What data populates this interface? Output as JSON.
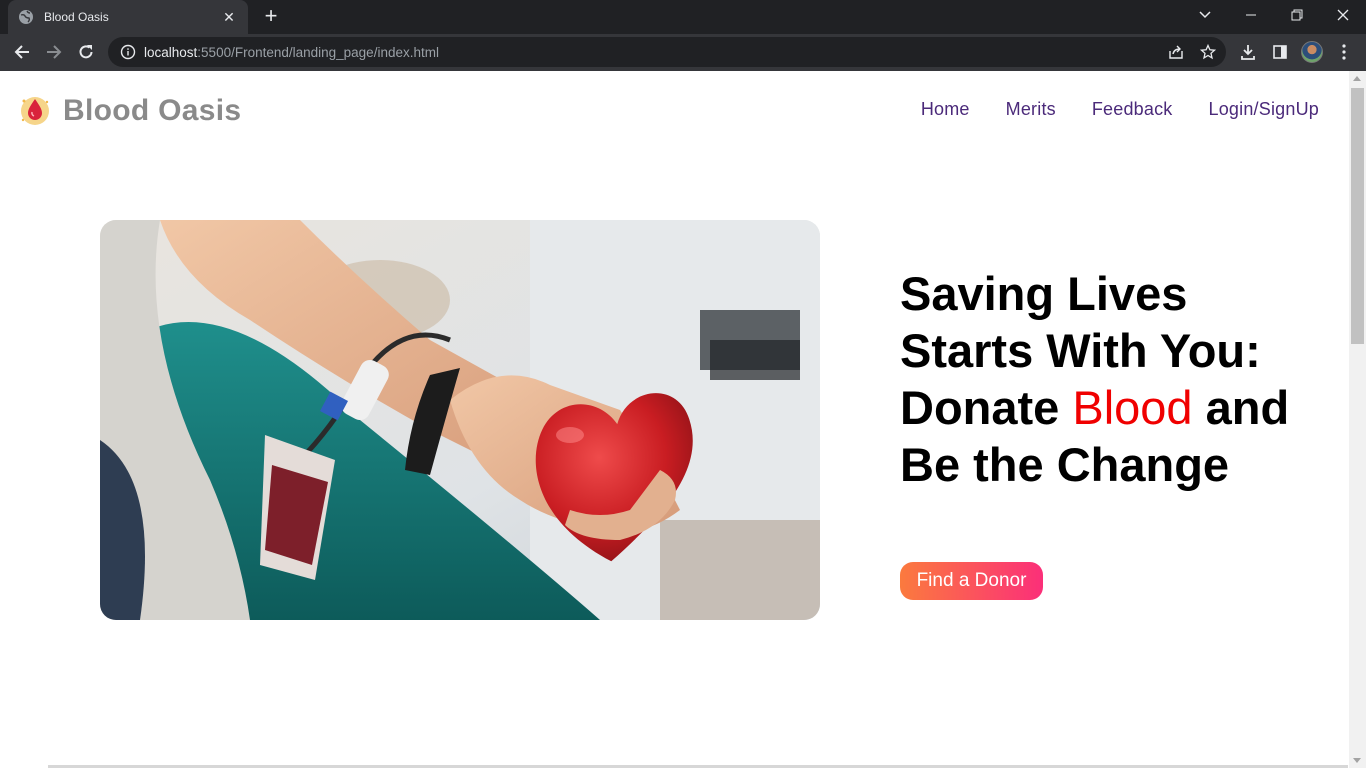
{
  "browser": {
    "tab_title": "Blood Oasis",
    "tab_close": "✕",
    "new_tab": "+",
    "url_host": "localhost",
    "url_path": ":5500/Frontend/landing_page/index.html"
  },
  "site": {
    "brand": "Blood Oasis",
    "nav": [
      "Home",
      "Merits",
      "Feedback",
      "Login/SignUp"
    ]
  },
  "hero": {
    "headline_part1": "Saving Lives Starts With You: Donate ",
    "headline_highlight": "Blood",
    "headline_part2": " and Be the Change",
    "cta_label": "Find a Donor"
  },
  "colors": {
    "accent_red": "#f00000",
    "nav_purple": "#4b2a7a",
    "cta_gradient_start": "#fb7a3e",
    "cta_gradient_end": "#fb2f79"
  }
}
